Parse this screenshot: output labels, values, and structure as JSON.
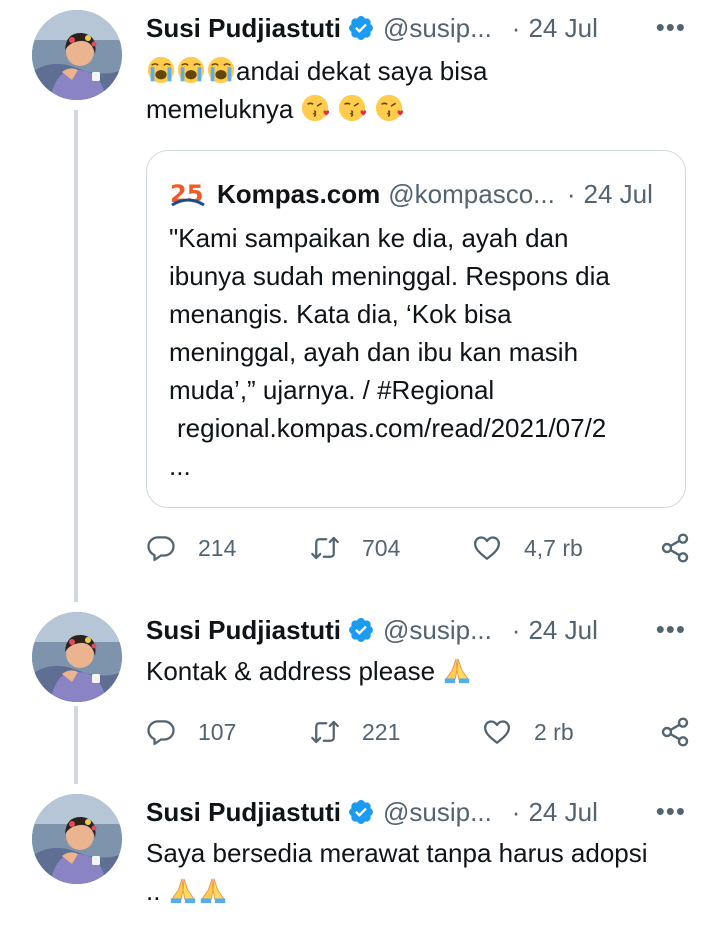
{
  "colors": {
    "text": "#0f1419",
    "muted": "#536471",
    "verified": "#1d9bf0",
    "border": "#cfd9de"
  },
  "tweets": [
    {
      "author": {
        "name": "Susi Pudjiastuti",
        "handle": "@susip...",
        "verified": true
      },
      "dot": "·",
      "date": "24 Jul",
      "more": "•••",
      "text_lines": [
        "andai dekat saya bisa",
        "memeluknya"
      ],
      "emoji_before": [
        "loudly-crying-face",
        "loudly-crying-face",
        "loudly-crying-face"
      ],
      "emoji_after": [
        "face-blowing-kiss",
        "face-blowing-kiss",
        "face-blowing-kiss"
      ],
      "quote": {
        "logo": "kompas-25-logo",
        "name": "Kompas.com",
        "handle": "@kompasco...",
        "dot": "·",
        "date": "24 Jul",
        "lines": [
          "\"Kami sampaikan ke dia, ayah dan",
          "ibunya sudah meninggal. Respons dia",
          "menangis. Kata dia, ‘Kok bisa",
          "meninggal, ayah dan ibu kan masih",
          "muda’,” ujarnya. / #Regional"
        ],
        "link": "regional.kompas.com/read/2021/07/2",
        "ellipsis": "..."
      },
      "stats": {
        "replies": "214",
        "retweets": "704",
        "likes": "4,7 rb"
      }
    },
    {
      "author": {
        "name": "Susi Pudjiastuti",
        "handle": "@susip...",
        "verified": true
      },
      "dot": "·",
      "date": "24 Jul",
      "more": "•••",
      "text": "Kontak & address please",
      "emoji_after": [
        "folded-hands"
      ],
      "stats": {
        "replies": "107",
        "retweets": "221",
        "likes": "2 rb"
      }
    },
    {
      "author": {
        "name": "Susi Pudjiastuti",
        "handle": "@susip...",
        "verified": true
      },
      "dot": "·",
      "date": "24 Jul",
      "more": "•••",
      "text_lines": [
        "Saya bersedia merawat tanpa harus adopsi",
        ".."
      ],
      "emoji_after": [
        "folded-hands",
        "folded-hands"
      ]
    }
  ],
  "icons": {
    "reply": "reply-icon",
    "retweet": "retweet-icon",
    "like": "like-icon",
    "share": "share-icon",
    "verified": "verified-badge-icon",
    "more": "more-options-icon"
  }
}
